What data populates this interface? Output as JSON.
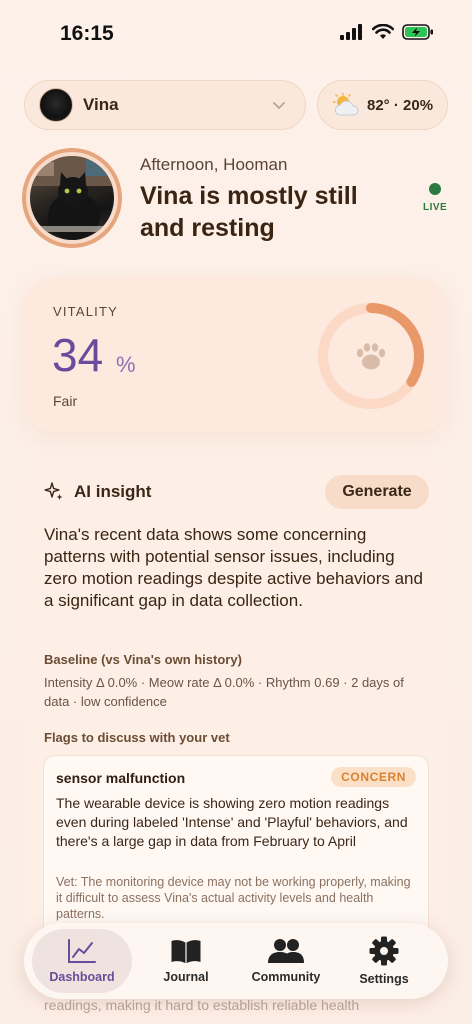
{
  "status_bar": {
    "time": "16:15"
  },
  "pet_selector": {
    "name": "Vina"
  },
  "weather": {
    "text": "82° · 20%",
    "icon": "partly-cloudy-icon"
  },
  "hero": {
    "greeting": "Afternoon, Hooman",
    "headline": "Vina is mostly still and resting",
    "live_label": "LIVE"
  },
  "vitality": {
    "label": "VITALITY",
    "value": "34",
    "unit": "%",
    "status": "Fair",
    "ring_fraction": 0.34,
    "icon": "paw-icon"
  },
  "insight": {
    "title": "AI insight",
    "generate_label": "Generate",
    "body": "Vina's recent data shows some concerning patterns with potential sensor issues, including zero motion readings despite active behaviors and a significant gap in data collection.",
    "baseline_label": "Baseline (vs Vina's own history)",
    "baseline_text": "Intensity Δ 0.0% · Meow rate Δ 0.0% · Rhythm 0.69 · 2 days of data · low confidence",
    "flags_label": "Flags to discuss with your vet",
    "flag": {
      "title": "sensor malfunction",
      "badge": "CONCERN",
      "description": "The wearable device is showing zero motion readings even during labeled 'Intense' and 'Playful' behaviors, and there's a large gap in data from February to April",
      "vet_note": "Vet: The monitoring device may not be working properly, making it difficult to assess Vina's actual activity levels and health patterns."
    },
    "overflow_text": "readings, making it hard to establish reliable health"
  },
  "nav": {
    "items": [
      {
        "label": "Dashboard",
        "icon": "chart-line-icon"
      },
      {
        "label": "Journal",
        "icon": "book-icon"
      },
      {
        "label": "Community",
        "icon": "people-icon"
      },
      {
        "label": "Settings",
        "icon": "gear-icon"
      }
    ]
  },
  "colors": {
    "accent_purple": "#6a4b9c",
    "live_green": "#2b7a3f",
    "ring_orange": "#e9986a",
    "concern_orange": "#d9822f"
  }
}
